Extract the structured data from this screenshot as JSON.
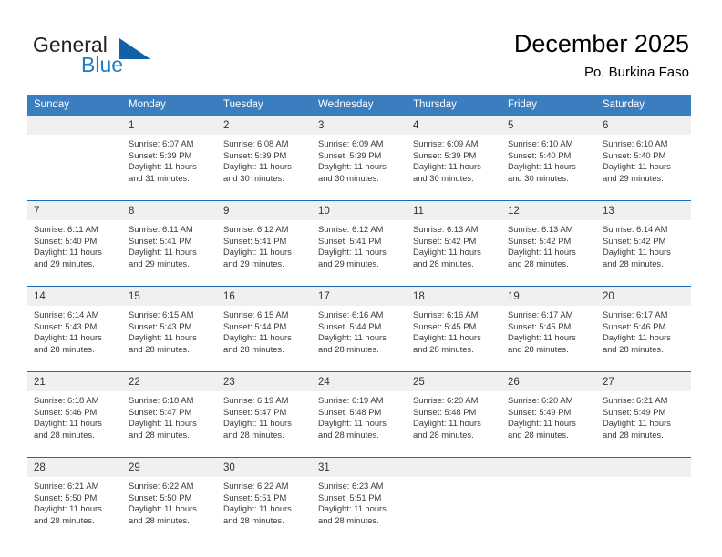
{
  "brand": {
    "name_part1": "General",
    "name_part2": "Blue",
    "triangle_icon": "triangle-icon"
  },
  "header": {
    "title": "December 2025",
    "subtitle": "Po, Burkina Faso"
  },
  "calendar": {
    "day_headers": [
      "Sunday",
      "Monday",
      "Tuesday",
      "Wednesday",
      "Thursday",
      "Friday",
      "Saturday"
    ],
    "colors": {
      "header_bg": "#3a7ebf",
      "header_text": "#ffffff",
      "daynum_bg": "#f0f0f0",
      "separator": "#1f6cb0",
      "brand_blue": "#1f7fc4",
      "brand_triangle": "#1260a8",
      "cell_text": "#3a3a3a"
    },
    "weeks": [
      {
        "days": [
          {
            "num": "",
            "sunrise": "",
            "sunset": "",
            "daylight_line1": "",
            "daylight_line2": ""
          },
          {
            "num": "1",
            "sunrise": "Sunrise: 6:07 AM",
            "sunset": "Sunset: 5:39 PM",
            "daylight_line1": "Daylight: 11 hours",
            "daylight_line2": "and 31 minutes."
          },
          {
            "num": "2",
            "sunrise": "Sunrise: 6:08 AM",
            "sunset": "Sunset: 5:39 PM",
            "daylight_line1": "Daylight: 11 hours",
            "daylight_line2": "and 30 minutes."
          },
          {
            "num": "3",
            "sunrise": "Sunrise: 6:09 AM",
            "sunset": "Sunset: 5:39 PM",
            "daylight_line1": "Daylight: 11 hours",
            "daylight_line2": "and 30 minutes."
          },
          {
            "num": "4",
            "sunrise": "Sunrise: 6:09 AM",
            "sunset": "Sunset: 5:39 PM",
            "daylight_line1": "Daylight: 11 hours",
            "daylight_line2": "and 30 minutes."
          },
          {
            "num": "5",
            "sunrise": "Sunrise: 6:10 AM",
            "sunset": "Sunset: 5:40 PM",
            "daylight_line1": "Daylight: 11 hours",
            "daylight_line2": "and 30 minutes."
          },
          {
            "num": "6",
            "sunrise": "Sunrise: 6:10 AM",
            "sunset": "Sunset: 5:40 PM",
            "daylight_line1": "Daylight: 11 hours",
            "daylight_line2": "and 29 minutes."
          }
        ]
      },
      {
        "days": [
          {
            "num": "7",
            "sunrise": "Sunrise: 6:11 AM",
            "sunset": "Sunset: 5:40 PM",
            "daylight_line1": "Daylight: 11 hours",
            "daylight_line2": "and 29 minutes."
          },
          {
            "num": "8",
            "sunrise": "Sunrise: 6:11 AM",
            "sunset": "Sunset: 5:41 PM",
            "daylight_line1": "Daylight: 11 hours",
            "daylight_line2": "and 29 minutes."
          },
          {
            "num": "9",
            "sunrise": "Sunrise: 6:12 AM",
            "sunset": "Sunset: 5:41 PM",
            "daylight_line1": "Daylight: 11 hours",
            "daylight_line2": "and 29 minutes."
          },
          {
            "num": "10",
            "sunrise": "Sunrise: 6:12 AM",
            "sunset": "Sunset: 5:41 PM",
            "daylight_line1": "Daylight: 11 hours",
            "daylight_line2": "and 29 minutes."
          },
          {
            "num": "11",
            "sunrise": "Sunrise: 6:13 AM",
            "sunset": "Sunset: 5:42 PM",
            "daylight_line1": "Daylight: 11 hours",
            "daylight_line2": "and 28 minutes."
          },
          {
            "num": "12",
            "sunrise": "Sunrise: 6:13 AM",
            "sunset": "Sunset: 5:42 PM",
            "daylight_line1": "Daylight: 11 hours",
            "daylight_line2": "and 28 minutes."
          },
          {
            "num": "13",
            "sunrise": "Sunrise: 6:14 AM",
            "sunset": "Sunset: 5:42 PM",
            "daylight_line1": "Daylight: 11 hours",
            "daylight_line2": "and 28 minutes."
          }
        ]
      },
      {
        "days": [
          {
            "num": "14",
            "sunrise": "Sunrise: 6:14 AM",
            "sunset": "Sunset: 5:43 PM",
            "daylight_line1": "Daylight: 11 hours",
            "daylight_line2": "and 28 minutes."
          },
          {
            "num": "15",
            "sunrise": "Sunrise: 6:15 AM",
            "sunset": "Sunset: 5:43 PM",
            "daylight_line1": "Daylight: 11 hours",
            "daylight_line2": "and 28 minutes."
          },
          {
            "num": "16",
            "sunrise": "Sunrise: 6:15 AM",
            "sunset": "Sunset: 5:44 PM",
            "daylight_line1": "Daylight: 11 hours",
            "daylight_line2": "and 28 minutes."
          },
          {
            "num": "17",
            "sunrise": "Sunrise: 6:16 AM",
            "sunset": "Sunset: 5:44 PM",
            "daylight_line1": "Daylight: 11 hours",
            "daylight_line2": "and 28 minutes."
          },
          {
            "num": "18",
            "sunrise": "Sunrise: 6:16 AM",
            "sunset": "Sunset: 5:45 PM",
            "daylight_line1": "Daylight: 11 hours",
            "daylight_line2": "and 28 minutes."
          },
          {
            "num": "19",
            "sunrise": "Sunrise: 6:17 AM",
            "sunset": "Sunset: 5:45 PM",
            "daylight_line1": "Daylight: 11 hours",
            "daylight_line2": "and 28 minutes."
          },
          {
            "num": "20",
            "sunrise": "Sunrise: 6:17 AM",
            "sunset": "Sunset: 5:46 PM",
            "daylight_line1": "Daylight: 11 hours",
            "daylight_line2": "and 28 minutes."
          }
        ]
      },
      {
        "days": [
          {
            "num": "21",
            "sunrise": "Sunrise: 6:18 AM",
            "sunset": "Sunset: 5:46 PM",
            "daylight_line1": "Daylight: 11 hours",
            "daylight_line2": "and 28 minutes."
          },
          {
            "num": "22",
            "sunrise": "Sunrise: 6:18 AM",
            "sunset": "Sunset: 5:47 PM",
            "daylight_line1": "Daylight: 11 hours",
            "daylight_line2": "and 28 minutes."
          },
          {
            "num": "23",
            "sunrise": "Sunrise: 6:19 AM",
            "sunset": "Sunset: 5:47 PM",
            "daylight_line1": "Daylight: 11 hours",
            "daylight_line2": "and 28 minutes."
          },
          {
            "num": "24",
            "sunrise": "Sunrise: 6:19 AM",
            "sunset": "Sunset: 5:48 PM",
            "daylight_line1": "Daylight: 11 hours",
            "daylight_line2": "and 28 minutes."
          },
          {
            "num": "25",
            "sunrise": "Sunrise: 6:20 AM",
            "sunset": "Sunset: 5:48 PM",
            "daylight_line1": "Daylight: 11 hours",
            "daylight_line2": "and 28 minutes."
          },
          {
            "num": "26",
            "sunrise": "Sunrise: 6:20 AM",
            "sunset": "Sunset: 5:49 PM",
            "daylight_line1": "Daylight: 11 hours",
            "daylight_line2": "and 28 minutes."
          },
          {
            "num": "27",
            "sunrise": "Sunrise: 6:21 AM",
            "sunset": "Sunset: 5:49 PM",
            "daylight_line1": "Daylight: 11 hours",
            "daylight_line2": "and 28 minutes."
          }
        ]
      },
      {
        "days": [
          {
            "num": "28",
            "sunrise": "Sunrise: 6:21 AM",
            "sunset": "Sunset: 5:50 PM",
            "daylight_line1": "Daylight: 11 hours",
            "daylight_line2": "and 28 minutes."
          },
          {
            "num": "29",
            "sunrise": "Sunrise: 6:22 AM",
            "sunset": "Sunset: 5:50 PM",
            "daylight_line1": "Daylight: 11 hours",
            "daylight_line2": "and 28 minutes."
          },
          {
            "num": "30",
            "sunrise": "Sunrise: 6:22 AM",
            "sunset": "Sunset: 5:51 PM",
            "daylight_line1": "Daylight: 11 hours",
            "daylight_line2": "and 28 minutes."
          },
          {
            "num": "31",
            "sunrise": "Sunrise: 6:23 AM",
            "sunset": "Sunset: 5:51 PM",
            "daylight_line1": "Daylight: 11 hours",
            "daylight_line2": "and 28 minutes."
          },
          {
            "num": "",
            "sunrise": "",
            "sunset": "",
            "daylight_line1": "",
            "daylight_line2": ""
          },
          {
            "num": "",
            "sunrise": "",
            "sunset": "",
            "daylight_line1": "",
            "daylight_line2": ""
          },
          {
            "num": "",
            "sunrise": "",
            "sunset": "",
            "daylight_line1": "",
            "daylight_line2": ""
          }
        ]
      }
    ]
  }
}
